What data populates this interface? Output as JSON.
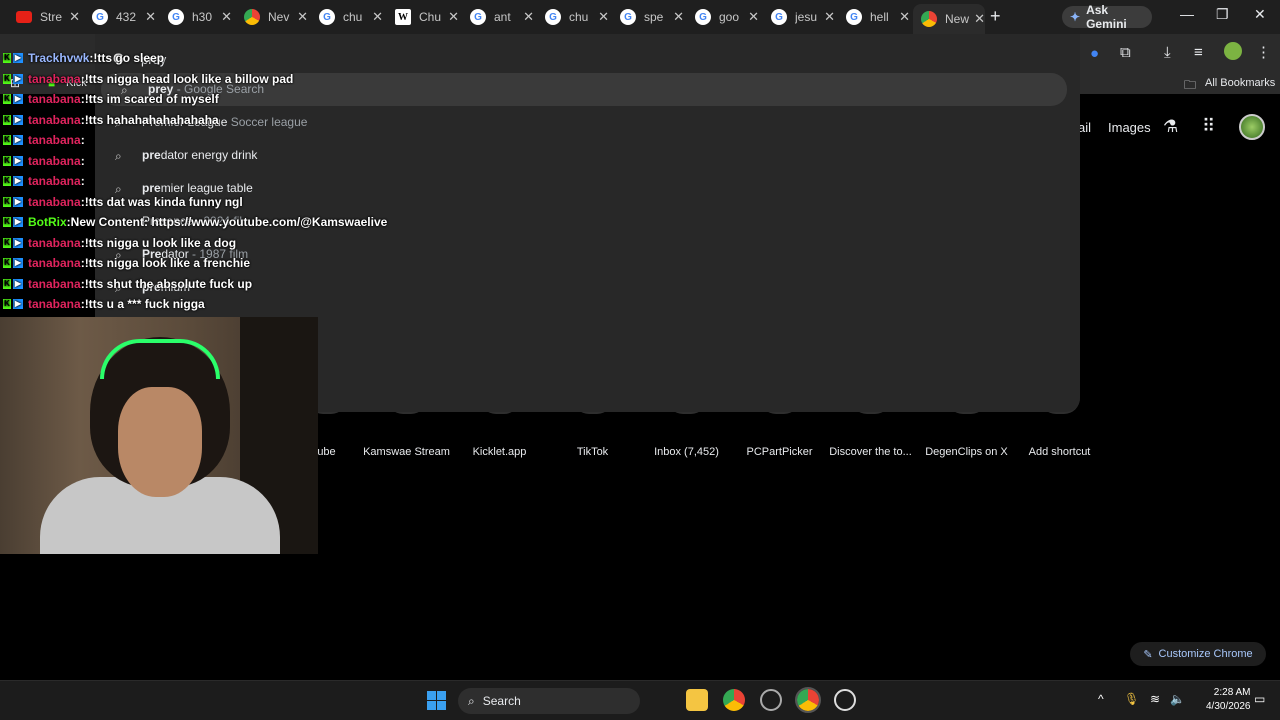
{
  "tabs": [
    {
      "label": "Stre",
      "favicon": "youtube"
    },
    {
      "label": "432",
      "favicon": "google"
    },
    {
      "label": "h30",
      "favicon": "google"
    },
    {
      "label": "Nev",
      "favicon": "chrome"
    },
    {
      "label": "chu",
      "favicon": "google"
    },
    {
      "label": "Chu",
      "favicon": "wikipedia"
    },
    {
      "label": "ant",
      "favicon": "google"
    },
    {
      "label": "chu",
      "favicon": "google"
    },
    {
      "label": "spe",
      "favicon": "google"
    },
    {
      "label": "goo",
      "favicon": "google"
    },
    {
      "label": "jesu",
      "favicon": "google"
    },
    {
      "label": "hell",
      "favicon": "google"
    },
    {
      "label": "New",
      "favicon": "chrome"
    }
  ],
  "ask_gemini": "Ask Gemini",
  "bookmarks": {
    "all_bookmarks": "All Bookmarks",
    "kick": "Kick"
  },
  "ntp_header": {
    "gmail": "ail",
    "images": "Images"
  },
  "omnibox": {
    "value": "prey",
    "suggestions": [
      {
        "bold": "prey",
        "rest": "",
        "sub": " - Google Search"
      },
      {
        "bold": "",
        "rest": "Premier League",
        "sub": " Soccer league"
      },
      {
        "bold": "pre",
        "rest": "dator energy drink",
        "sub": ""
      },
      {
        "bold": "pre",
        "rest": "mier league table",
        "sub": ""
      },
      {
        "bold": "",
        "rest": "Presence",
        "sub": " - 2024 fil"
      },
      {
        "bold": "Pre",
        "rest": "dator",
        "sub": " - 1987 film"
      },
      {
        "bold": "pre",
        "rest": "mium",
        "sub": ""
      }
    ]
  },
  "shortcuts": [
    {
      "label": "ube"
    },
    {
      "label": "Kamswae Stream"
    },
    {
      "label": "Kicklet.app"
    },
    {
      "label": "TikTok"
    },
    {
      "label": "Inbox (7,452)"
    },
    {
      "label": "PCPartPicker"
    },
    {
      "label": "Discover the to..."
    },
    {
      "label": "DegenClips on X"
    },
    {
      "label": "Add shortcut"
    }
  ],
  "customize_chrome": "Customize Chrome",
  "chat": [
    {
      "user": "Trackhvwk",
      "color": "#9ab8ff",
      "text": "!tts go sleep"
    },
    {
      "user": "tanabana",
      "color": "#e0245e",
      "text": "!tts nigga head look like a billow pad"
    },
    {
      "user": "tanabana",
      "color": "#e0245e",
      "text": "!tts im scared of myself"
    },
    {
      "user": "tanabana",
      "color": "#e0245e",
      "text": "!tts hahahahahahahaha"
    },
    {
      "user": "tanabana",
      "color": "#e0245e",
      "text": ""
    },
    {
      "user": "tanabana",
      "color": "#e0245e",
      "text": ""
    },
    {
      "user": "tanabana",
      "color": "#e0245e",
      "text": ""
    },
    {
      "user": "tanabana",
      "color": "#e0245e",
      "text": "!tts dat was kinda funny ngl"
    },
    {
      "user": "BotRix",
      "color": "#53fc18",
      "text": "New Content: https://www.youtube.com/@Kamswaelive"
    },
    {
      "user": "tanabana",
      "color": "#e0245e",
      "text": "!tts nigga u look like a dog"
    },
    {
      "user": "tanabana",
      "color": "#e0245e",
      "text": "!tts nigga look like a frenchie"
    },
    {
      "user": "tanabana",
      "color": "#e0245e",
      "text": "!tts shut the absolute fuck up"
    },
    {
      "user": "tanabana",
      "color": "#e0245e",
      "text": "!tts u a *** fuck nigga"
    }
  ],
  "taskbar": {
    "search": "Search",
    "time": "2:28 AM",
    "date": "4/30/2026"
  }
}
